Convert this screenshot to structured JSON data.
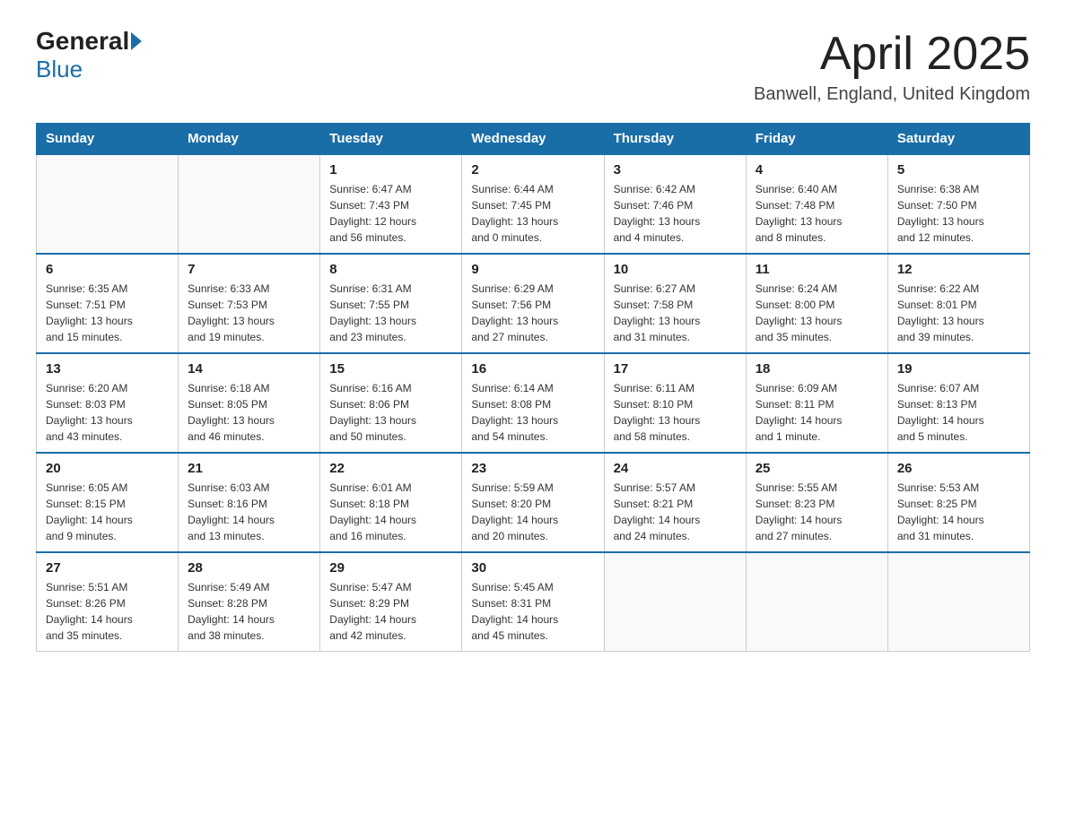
{
  "header": {
    "logo_general": "General",
    "logo_blue": "Blue",
    "title": "April 2025",
    "subtitle": "Banwell, England, United Kingdom"
  },
  "calendar": {
    "days_of_week": [
      "Sunday",
      "Monday",
      "Tuesday",
      "Wednesday",
      "Thursday",
      "Friday",
      "Saturday"
    ],
    "weeks": [
      [
        {
          "day": "",
          "info": ""
        },
        {
          "day": "",
          "info": ""
        },
        {
          "day": "1",
          "info": "Sunrise: 6:47 AM\nSunset: 7:43 PM\nDaylight: 12 hours\nand 56 minutes."
        },
        {
          "day": "2",
          "info": "Sunrise: 6:44 AM\nSunset: 7:45 PM\nDaylight: 13 hours\nand 0 minutes."
        },
        {
          "day": "3",
          "info": "Sunrise: 6:42 AM\nSunset: 7:46 PM\nDaylight: 13 hours\nand 4 minutes."
        },
        {
          "day": "4",
          "info": "Sunrise: 6:40 AM\nSunset: 7:48 PM\nDaylight: 13 hours\nand 8 minutes."
        },
        {
          "day": "5",
          "info": "Sunrise: 6:38 AM\nSunset: 7:50 PM\nDaylight: 13 hours\nand 12 minutes."
        }
      ],
      [
        {
          "day": "6",
          "info": "Sunrise: 6:35 AM\nSunset: 7:51 PM\nDaylight: 13 hours\nand 15 minutes."
        },
        {
          "day": "7",
          "info": "Sunrise: 6:33 AM\nSunset: 7:53 PM\nDaylight: 13 hours\nand 19 minutes."
        },
        {
          "day": "8",
          "info": "Sunrise: 6:31 AM\nSunset: 7:55 PM\nDaylight: 13 hours\nand 23 minutes."
        },
        {
          "day": "9",
          "info": "Sunrise: 6:29 AM\nSunset: 7:56 PM\nDaylight: 13 hours\nand 27 minutes."
        },
        {
          "day": "10",
          "info": "Sunrise: 6:27 AM\nSunset: 7:58 PM\nDaylight: 13 hours\nand 31 minutes."
        },
        {
          "day": "11",
          "info": "Sunrise: 6:24 AM\nSunset: 8:00 PM\nDaylight: 13 hours\nand 35 minutes."
        },
        {
          "day": "12",
          "info": "Sunrise: 6:22 AM\nSunset: 8:01 PM\nDaylight: 13 hours\nand 39 minutes."
        }
      ],
      [
        {
          "day": "13",
          "info": "Sunrise: 6:20 AM\nSunset: 8:03 PM\nDaylight: 13 hours\nand 43 minutes."
        },
        {
          "day": "14",
          "info": "Sunrise: 6:18 AM\nSunset: 8:05 PM\nDaylight: 13 hours\nand 46 minutes."
        },
        {
          "day": "15",
          "info": "Sunrise: 6:16 AM\nSunset: 8:06 PM\nDaylight: 13 hours\nand 50 minutes."
        },
        {
          "day": "16",
          "info": "Sunrise: 6:14 AM\nSunset: 8:08 PM\nDaylight: 13 hours\nand 54 minutes."
        },
        {
          "day": "17",
          "info": "Sunrise: 6:11 AM\nSunset: 8:10 PM\nDaylight: 13 hours\nand 58 minutes."
        },
        {
          "day": "18",
          "info": "Sunrise: 6:09 AM\nSunset: 8:11 PM\nDaylight: 14 hours\nand 1 minute."
        },
        {
          "day": "19",
          "info": "Sunrise: 6:07 AM\nSunset: 8:13 PM\nDaylight: 14 hours\nand 5 minutes."
        }
      ],
      [
        {
          "day": "20",
          "info": "Sunrise: 6:05 AM\nSunset: 8:15 PM\nDaylight: 14 hours\nand 9 minutes."
        },
        {
          "day": "21",
          "info": "Sunrise: 6:03 AM\nSunset: 8:16 PM\nDaylight: 14 hours\nand 13 minutes."
        },
        {
          "day": "22",
          "info": "Sunrise: 6:01 AM\nSunset: 8:18 PM\nDaylight: 14 hours\nand 16 minutes."
        },
        {
          "day": "23",
          "info": "Sunrise: 5:59 AM\nSunset: 8:20 PM\nDaylight: 14 hours\nand 20 minutes."
        },
        {
          "day": "24",
          "info": "Sunrise: 5:57 AM\nSunset: 8:21 PM\nDaylight: 14 hours\nand 24 minutes."
        },
        {
          "day": "25",
          "info": "Sunrise: 5:55 AM\nSunset: 8:23 PM\nDaylight: 14 hours\nand 27 minutes."
        },
        {
          "day": "26",
          "info": "Sunrise: 5:53 AM\nSunset: 8:25 PM\nDaylight: 14 hours\nand 31 minutes."
        }
      ],
      [
        {
          "day": "27",
          "info": "Sunrise: 5:51 AM\nSunset: 8:26 PM\nDaylight: 14 hours\nand 35 minutes."
        },
        {
          "day": "28",
          "info": "Sunrise: 5:49 AM\nSunset: 8:28 PM\nDaylight: 14 hours\nand 38 minutes."
        },
        {
          "day": "29",
          "info": "Sunrise: 5:47 AM\nSunset: 8:29 PM\nDaylight: 14 hours\nand 42 minutes."
        },
        {
          "day": "30",
          "info": "Sunrise: 5:45 AM\nSunset: 8:31 PM\nDaylight: 14 hours\nand 45 minutes."
        },
        {
          "day": "",
          "info": ""
        },
        {
          "day": "",
          "info": ""
        },
        {
          "day": "",
          "info": ""
        }
      ]
    ]
  }
}
